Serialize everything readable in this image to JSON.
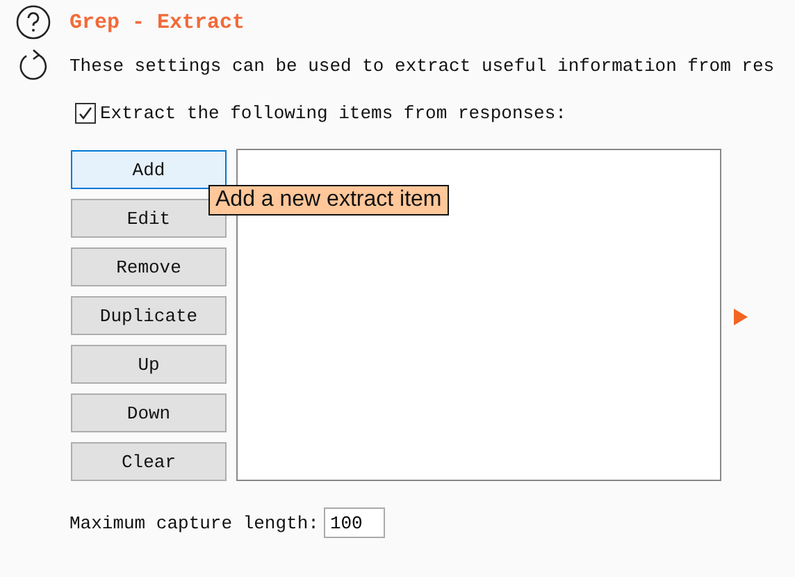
{
  "section": {
    "title": "Grep - Extract",
    "description": "These settings can be used to extract useful information from res"
  },
  "extract_option": {
    "label": "Extract the following items from responses:",
    "checked": true
  },
  "buttons": [
    {
      "label": "Add",
      "highlighted": true
    },
    {
      "label": "Edit",
      "highlighted": false
    },
    {
      "label": "Remove",
      "highlighted": false
    },
    {
      "label": "Duplicate",
      "highlighted": false
    },
    {
      "label": "Up",
      "highlighted": false
    },
    {
      "label": "Down",
      "highlighted": false
    },
    {
      "label": "Clear",
      "highlighted": false
    }
  ],
  "tooltip": {
    "text": "Add a new extract item"
  },
  "max_capture": {
    "label": "Maximum capture length:",
    "value": "100"
  }
}
